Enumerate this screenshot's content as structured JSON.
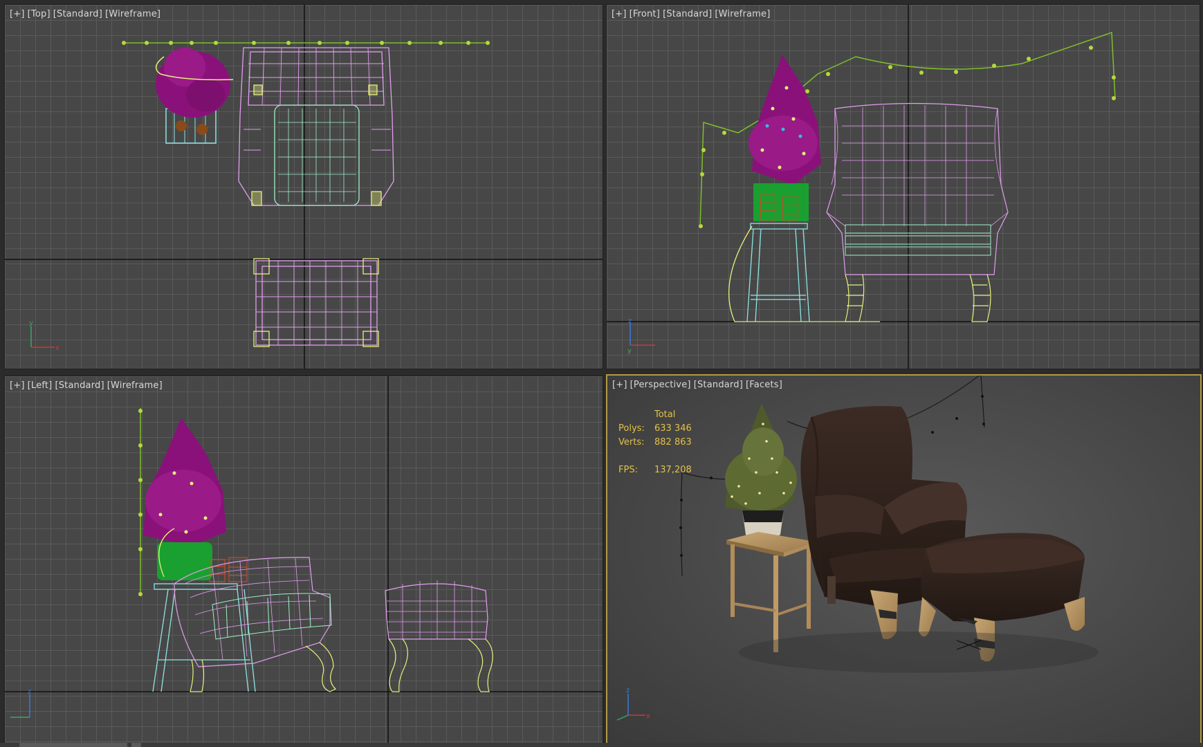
{
  "viewports": {
    "top": {
      "plus": "[+]",
      "view": "[Top]",
      "shading_style": "[Standard]",
      "display_mode": "[Wireframe]"
    },
    "front": {
      "plus": "[+]",
      "view": "[Front]",
      "shading_style": "[Standard]",
      "display_mode": "[Wireframe]"
    },
    "left": {
      "plus": "[+]",
      "view": "[Left]",
      "shading_style": "[Standard]",
      "display_mode": "[Wireframe]"
    },
    "perspective": {
      "plus": "[+]",
      "view": "[Perspective]",
      "shading_style": "[Standard]",
      "display_mode": "[Facets]",
      "stats": {
        "header": "Total",
        "polys_label": "Polys:",
        "polys_value": "633 346",
        "verts_label": "Verts:",
        "verts_value": "882 863",
        "fps_label": "FPS:",
        "fps_value": "137,208"
      }
    }
  },
  "colors": {
    "chair_wire": "#e39ef0",
    "cushion_wire": "#9ff0c8",
    "legs_wire": "#e8f27a",
    "tree": "#8a117a",
    "garland": "#7fbf2a",
    "stool_wire": "#8ee6e6",
    "active_border": "#b39a46",
    "stats_text": "#e2c14a"
  }
}
